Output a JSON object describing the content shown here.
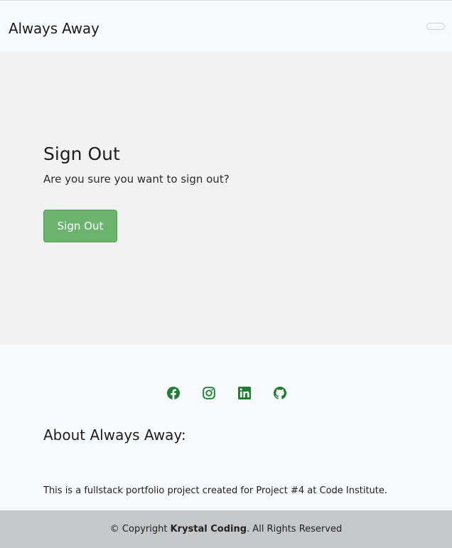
{
  "navbar": {
    "brand": "Always Away"
  },
  "main": {
    "title": "Sign Out",
    "question": "Are you sure you want to sign out?",
    "button_label": "Sign Out"
  },
  "footer": {
    "social_icons": [
      "facebook-icon",
      "instagram-icon",
      "linkedin-icon",
      "github-icon"
    ],
    "icon_color": "#1e7e34",
    "about_title": "About Always Away:",
    "about_text": "This is a fullstack portfolio project created for Project #4 at Code Institute.",
    "copyright_prefix": "© Copyright ",
    "copyright_owner": "Krystal Coding",
    "copyright_suffix": ". All Rights Reserved"
  },
  "colors": {
    "button_bg": "#6bb36f",
    "main_bg": "#f2f2f2",
    "footer_bg": "#f8f9fa",
    "copyright_bg": "#c6c7c9"
  }
}
